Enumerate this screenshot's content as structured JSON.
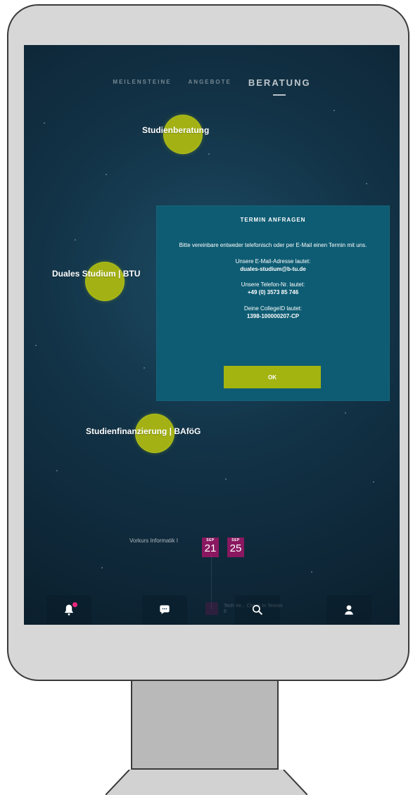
{
  "tabs": {
    "milestones": "MEILENSTEINE",
    "offers": "ANGEBOTE",
    "consulting": "BERATUNG"
  },
  "nodes": {
    "study_consulting": "Studienberatung",
    "dual_study": "Duales Studium | BTU",
    "financing": "Studienfinanzierung | BAföG"
  },
  "modal": {
    "title": "TERMIN ANFRAGEN",
    "intro": "Bitte vereinbare entweder telefonisch oder per E-Mail einen Termin mit uns.",
    "email_label": "Unsere E-Mail-Adresse lautet:",
    "email_value": "duales-studium@b-tu.de",
    "phone_label": "Unsere Telefon-Nr. lautet:",
    "phone_value": "+49 (0) 3573 85 746",
    "collegeid_label": "Deine CollegeID lautet:",
    "collegeid_value": "1398-100000207-CP",
    "ok_label": "OK"
  },
  "course": {
    "label": "Vorkurs Informatik I",
    "dates": [
      {
        "month": "SEP",
        "day": "21"
      },
      {
        "month": "SEP",
        "day": "25"
      }
    ]
  },
  "bottom_ghost": {
    "line1": "Tech Ve... Check In Termin",
    "line2": "6"
  },
  "icons": {
    "bell": "bell-icon",
    "chat": "chat-icon",
    "search": "search-icon",
    "profile": "profile-icon"
  },
  "colors": {
    "accent_green": "#a3b114",
    "modal_blue": "#0e5c73",
    "date_magenta": "#8a1861",
    "notification_pink": "#e9267d"
  }
}
